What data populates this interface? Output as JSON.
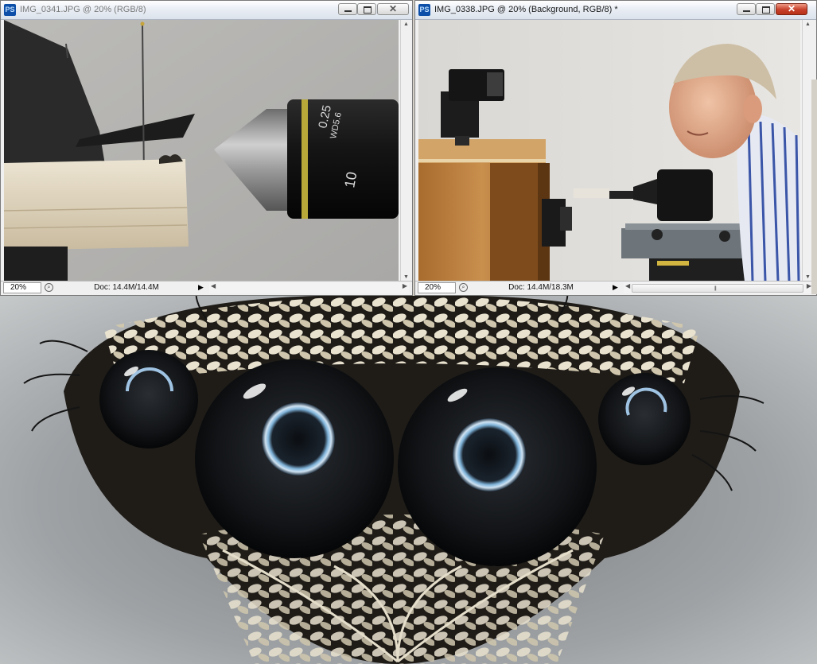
{
  "windows": [
    {
      "app_icon": "PS",
      "title": "IMG_0341.JPG @ 20% (RGB/8)",
      "zoom": "20%",
      "doc_info": "Doc: 14.4M/14.4M",
      "active": false
    },
    {
      "app_icon": "PS",
      "title": "IMG_0338.JPG @ 20% (Background, RGB/8) *",
      "zoom": "20%",
      "doc_info": "Doc: 14.4M/18.3M",
      "active": true
    }
  ],
  "photo1": {
    "lens_text_top": "0.25",
    "lens_text_side": "WD5.6",
    "lens_text_mag": "10"
  },
  "icons": {
    "minimize": "minimize-icon",
    "maximize": "maximize-icon",
    "close": "close-icon",
    "zoom_options": "zoom-options-icon",
    "status_menu": "triangle-right-icon"
  },
  "colors": {
    "titlebar": "#e9eef5",
    "close_active": "#c8402a",
    "ps_icon": "#0d4fa8"
  }
}
